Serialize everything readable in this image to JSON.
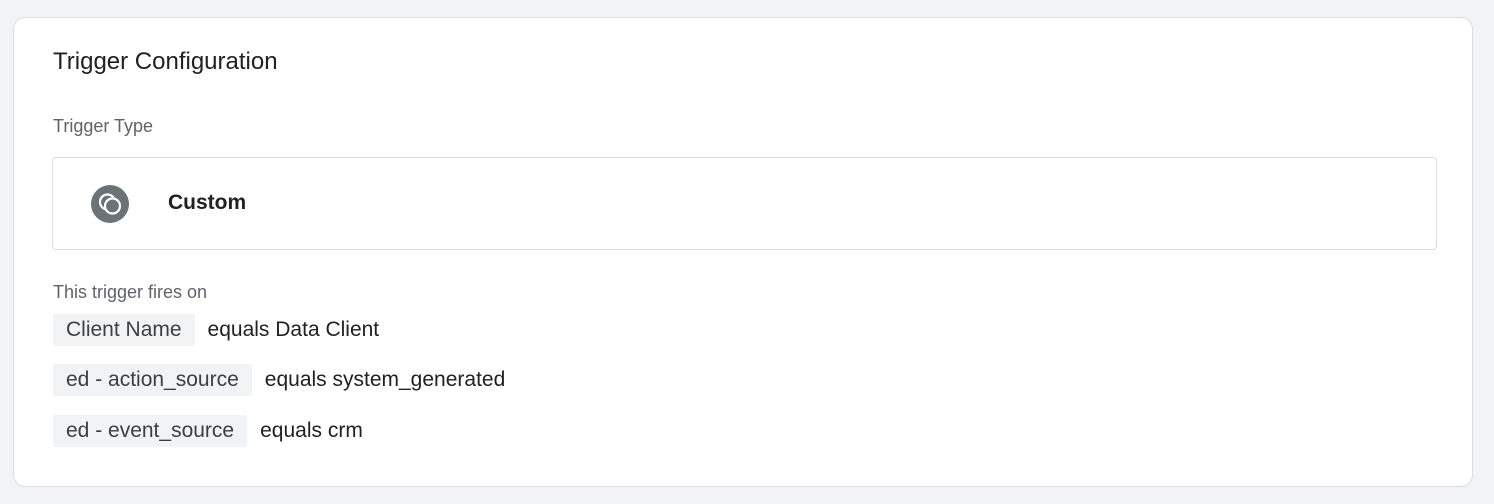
{
  "card": {
    "title": "Trigger Configuration",
    "trigger_type_label": "Trigger Type",
    "trigger_type": {
      "icon": "custom-trigger-icon",
      "name": "Custom"
    },
    "fires_on_label": "This trigger fires on",
    "conditions": [
      {
        "variable": "Client Name",
        "operator_value": "equals Data Client"
      },
      {
        "variable": "ed - action_source",
        "operator_value": "equals system_generated"
      },
      {
        "variable": "ed - event_source",
        "operator_value": "equals crm"
      }
    ]
  },
  "colors": {
    "icon_background": "#6b7378",
    "chip_background": "#f1f3f4",
    "border": "#dadce0"
  }
}
